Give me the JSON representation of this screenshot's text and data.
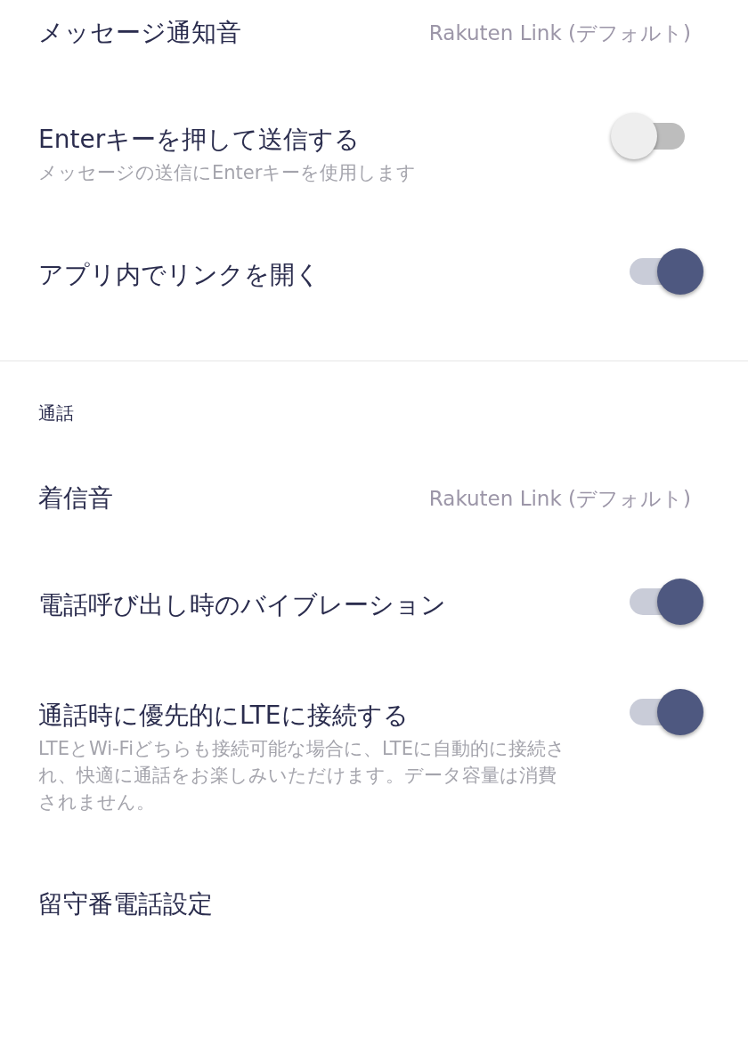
{
  "sections": [
    {
      "items": [
        {
          "kind": "value",
          "title": "メッセージ通知音",
          "value": "Rakuten Link (デフォルト)"
        },
        {
          "kind": "toggle",
          "title": "Enterキーを押して送信する",
          "subtitle": "メッセージの送信にEnterキーを使用します",
          "on": false
        },
        {
          "kind": "toggle",
          "title": "アプリ内でリンクを開く",
          "on": true
        }
      ]
    },
    {
      "header": "通話",
      "items": [
        {
          "kind": "value",
          "title": "着信音",
          "value": "Rakuten Link (デフォルト)"
        },
        {
          "kind": "toggle",
          "title": "電話呼び出し時のバイブレーション",
          "on": true
        },
        {
          "kind": "toggle",
          "title": "通話時に優先的にLTEに接続する",
          "subtitle": "LTEとWi-Fiどちらも接続可能な場合に、LTEに自動的に接続され、快適に通話をお楽しみいただけます。データ容量は消費されません。",
          "on": true
        },
        {
          "kind": "link",
          "title": "留守番電話設定"
        }
      ]
    }
  ]
}
